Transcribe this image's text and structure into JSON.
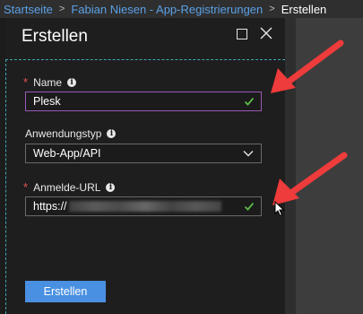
{
  "breadcrumb": {
    "items": [
      "Startseite",
      "Fabian Niesen - App-Registrierungen"
    ],
    "current": "Erstellen",
    "separator": ">"
  },
  "blade": {
    "title": "Erstellen"
  },
  "form": {
    "name": {
      "label": "Name",
      "required_mark": "*",
      "value": "Plesk"
    },
    "app_type": {
      "label": "Anwendungstyp",
      "value": "Web-App/API"
    },
    "signon_url": {
      "label": "Anmelde-URL",
      "required_mark": "*",
      "value": "https://"
    }
  },
  "actions": {
    "create_label": "Erstellen"
  },
  "colors": {
    "accent_blue": "#4a90e2",
    "link_blue": "#5aa0e6",
    "valid_green": "#5bb946",
    "required_red": "#e85252",
    "annotation_arrow": "#ee3b3b",
    "active_border": "#9b59b6"
  },
  "icons": [
    "maximize-icon",
    "close-icon",
    "info-icon",
    "checkmark-icon",
    "chevron-down-icon",
    "annotation-arrow",
    "mouse-pointer-icon"
  ]
}
